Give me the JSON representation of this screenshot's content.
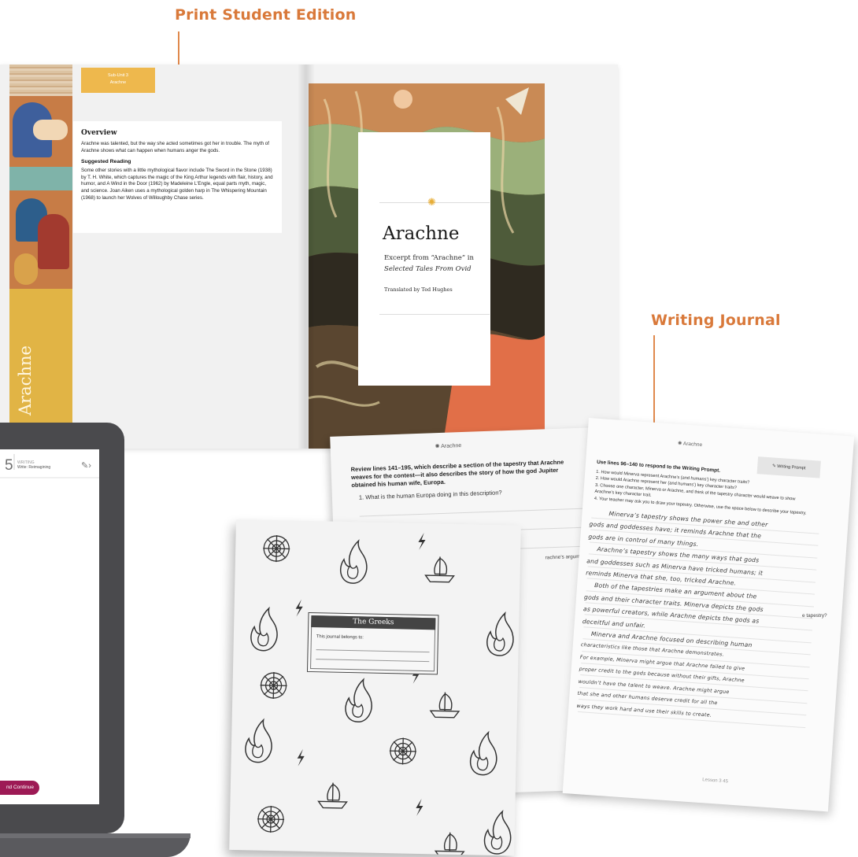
{
  "callouts": {
    "print": "Print Student Edition",
    "journal": "Writing Journal"
  },
  "print_edition": {
    "side_title": "Arachne",
    "subunit_tab": "Sub-Unit 3",
    "subunit_name": "Arachne",
    "overview": {
      "heading": "Overview",
      "text": "Arachne was talented, but the way she acted sometimes got her in trouble. The myth of Arachne shows what can happen when humans anger the gods.",
      "suggested_heading": "Suggested Reading",
      "suggested_text": "Some other stories with a little mythological flavor include The Sword in the Stone (1938) by T. H. White, which captures the magic of the King Arthur legends with flair, history, and humor, and A Wind in the Door (1962) by Madeleine L'Engle, equal parts myth, magic, and science. Joan Aiken uses a mythological golden harp in The Whispering Mountain (1968) to launch her Wolves of Willoughby Chase series."
    },
    "title_card": {
      "title": "Arachne",
      "excerpt_line1": "Excerpt from “Arachne” in",
      "excerpt_line2": "Selected Tales From Ovid",
      "translator": "Translated by Ted Hughes"
    },
    "colors": {
      "accent": "#eeb84d",
      "strip": "#e1b445"
    }
  },
  "laptop": {
    "lesson_number": "5",
    "section_label": "WRITING",
    "section_title": "Write: Reimagining",
    "continue_button": "nd Continue",
    "accent": "#9d1a55"
  },
  "journal": {
    "left_page": {
      "header": "Arachne",
      "prompt": "Review lines 141–195, which describe a section of the tapestry that Arachne weaves for the contest—it also describes the story of how the god Jupiter obtained his human wife, Europa.",
      "question1": "1.   What is the human Europa doing in this description?",
      "fragment": "rachne’s argument that the gods"
    },
    "right_page": {
      "header": "Arachne",
      "tag": "Writing Prompt",
      "intro": "Use lines 96–140 to respond to the Writing Prompt.",
      "items": [
        "1. How would Minerva represent Arachne’s (and humans’) key character traits?",
        "2. How would Arachne represent her (and humans’) key character traits?",
        "3. Choose one character, Minerva or Arachne, and think of the tapestry character would weave to show Arachne’s key character trait.",
        "4. Your teacher may ask you to draw your tapestry. Otherwise, use the space below to describe your tapestry."
      ],
      "handwriting": [
        "Minerva’s tapestry shows the power she and other",
        "gods and goddesses have; it reminds Arachne that the",
        "gods are in control of many things.",
        "Arachne’s tapestry shows the many ways that gods",
        "and goddesses such as Minerva have tricked humans; it",
        "reminds Minerva that she, too, tricked Arachne.",
        "Both of the tapestries make an argument about the",
        "gods and their character traits. Minerva depicts the gods",
        "as powerful creators, while Arachne depicts the gods as",
        "deceitful and unfair.",
        "Minerva and Arachne focused on describing human",
        "characteristics like those that Arachne demonstrates.",
        "For example, Minerva might argue that Arachne failed to give",
        "proper credit to the gods because without their gifts, Arachne",
        "wouldn’t have the talent to weave. Arachne might argue",
        "that she and other humans deserve credit for all the",
        "ways they work hard and use their skills to create."
      ],
      "edge_fragment": "e tapestry?",
      "footer": "Lesson 3   45"
    },
    "cover": {
      "title": "The Greeks",
      "belongs": "This journal belongs to:"
    }
  }
}
